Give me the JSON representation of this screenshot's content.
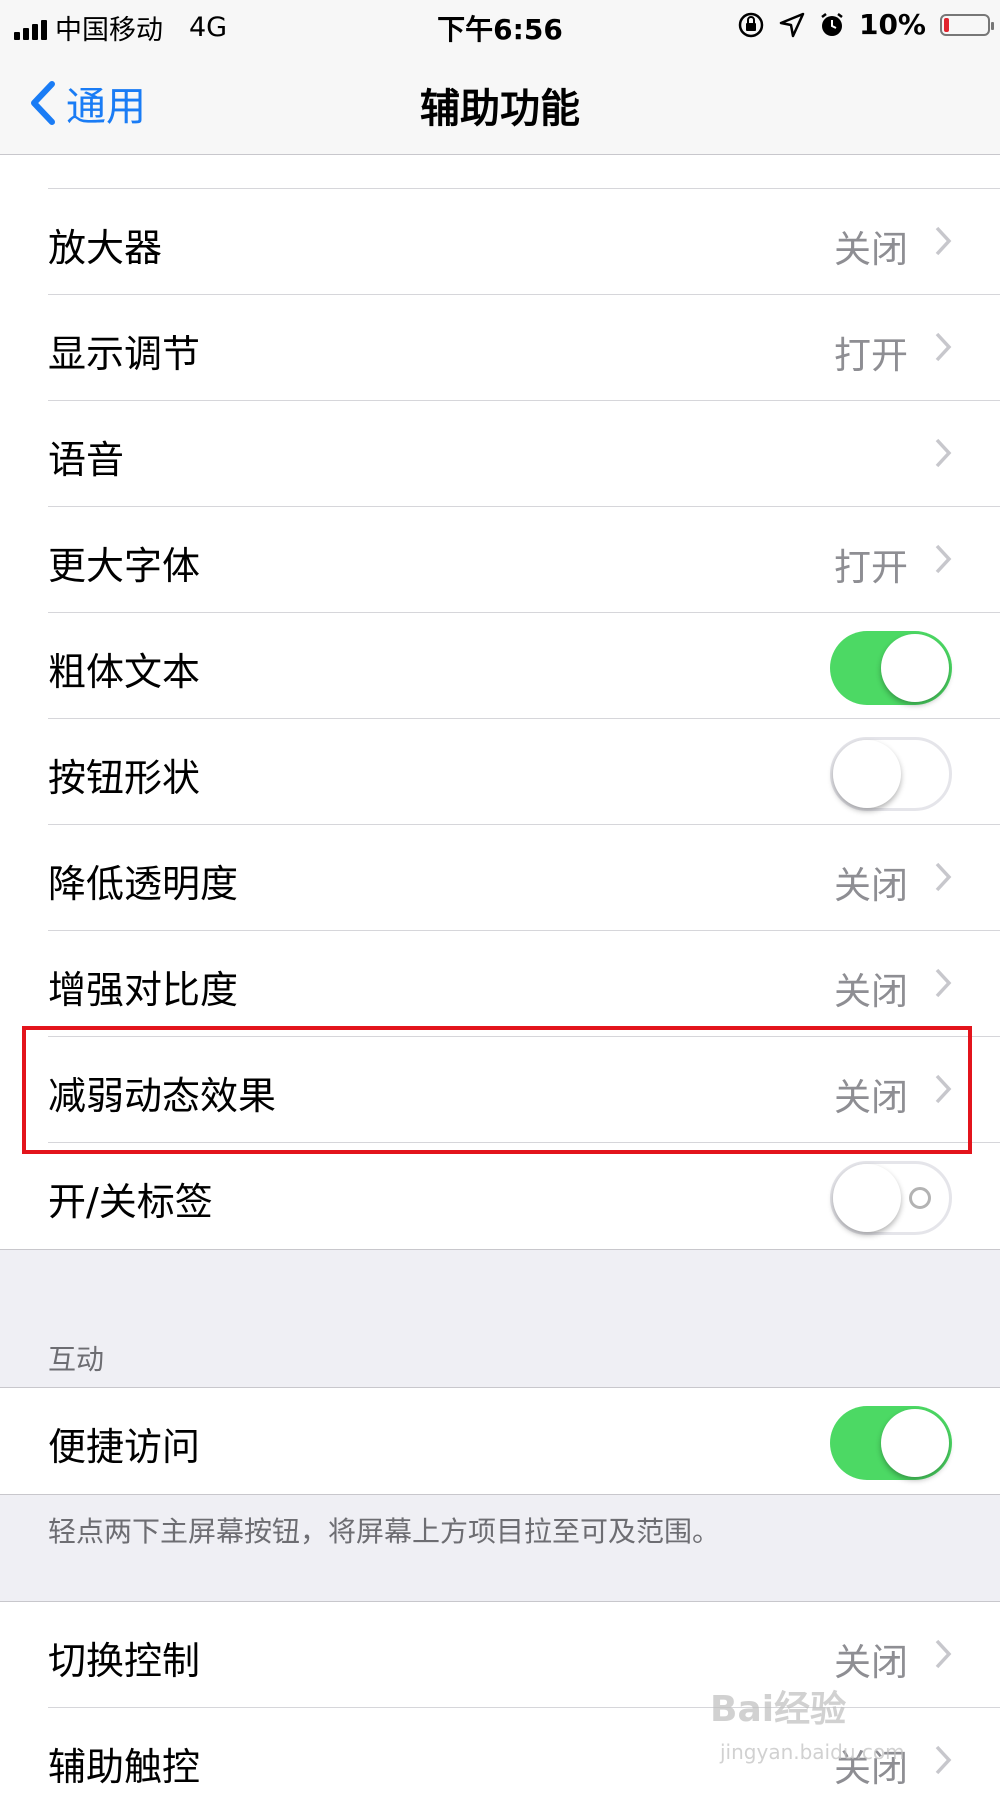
{
  "status_bar": {
    "carrier": "中国移动",
    "network": "4G",
    "time": "下午6:56",
    "battery_percent": "10%",
    "battery_level": 0.1
  },
  "nav": {
    "back_label": "通用",
    "title": "辅助功能"
  },
  "vision_group": {
    "rows": [
      {
        "label": "放大器",
        "value": "关闭"
      },
      {
        "label": "显示调节",
        "value": "打开"
      },
      {
        "label": "语音",
        "value": ""
      },
      {
        "label": "更大字体",
        "value": "打开"
      },
      {
        "label": "粗体文本",
        "toggle": "on"
      },
      {
        "label": "按钮形状",
        "toggle": "off"
      },
      {
        "label": "降低透明度",
        "value": "关闭"
      },
      {
        "label": "增强对比度",
        "value": "关闭"
      },
      {
        "label": "减弱动态效果",
        "value": "关闭"
      },
      {
        "label": "开/关标签",
        "toggle": "off"
      }
    ]
  },
  "interaction": {
    "header": "互动",
    "reachability": {
      "label": "便捷访问",
      "toggle": "on"
    },
    "footer": "轻点两下主屏幕按钮，将屏幕上方项目拉至可及范围。"
  },
  "more_group": {
    "rows": [
      {
        "label": "切换控制",
        "value": "关闭"
      },
      {
        "label": "辅助触控",
        "value": "关闭"
      }
    ]
  },
  "watermark": {
    "brand": "Bai经验",
    "url": "jingyan.baidu.com"
  },
  "colors": {
    "accent": "#1a7cf5",
    "toggle_on": "#4cd964",
    "highlight": "#e3141c",
    "value_gray": "#8e8e93"
  }
}
